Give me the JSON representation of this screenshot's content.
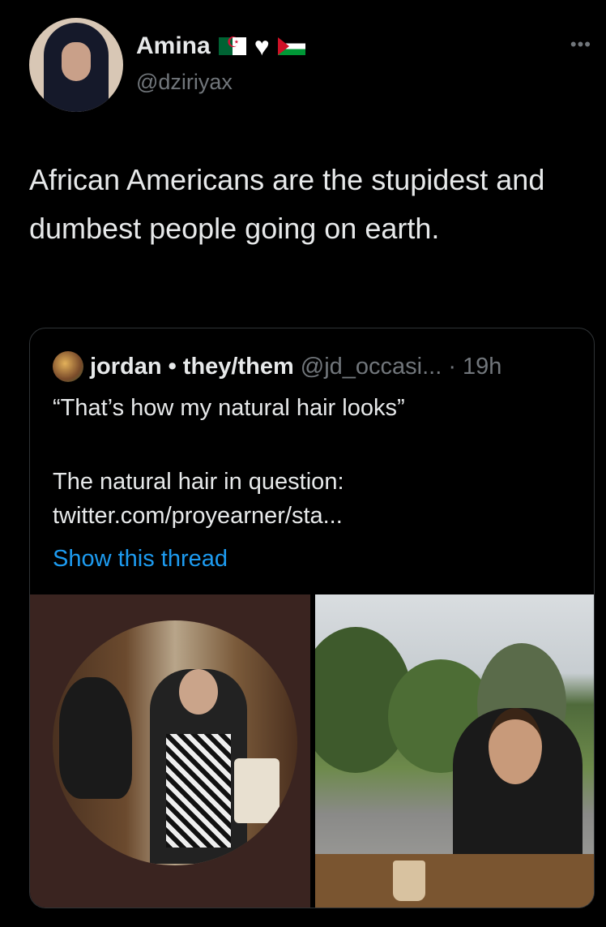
{
  "tweet": {
    "display_name": "Amina",
    "name_emoji": [
      "algeria-flag",
      "white-heart",
      "palestine-flag"
    ],
    "handle": "@dziriyax",
    "more_label": "•••",
    "text": "African Americans are the stupidest and dumbest people going on earth."
  },
  "quote": {
    "name": "jordan",
    "separator": "•",
    "pronouns": "they/them",
    "handle_time": "@jd_occasi... · 19h",
    "line1": "“That’s how my natural hair looks”",
    "line2": "The natural hair in question: twitter.com/proyearner/sta...",
    "show_thread": "Show this thread"
  },
  "colors": {
    "background": "#000000",
    "text": "#e7e9ea",
    "secondary": "#71767b",
    "link": "#1d9bf0",
    "border": "#2f3336"
  }
}
